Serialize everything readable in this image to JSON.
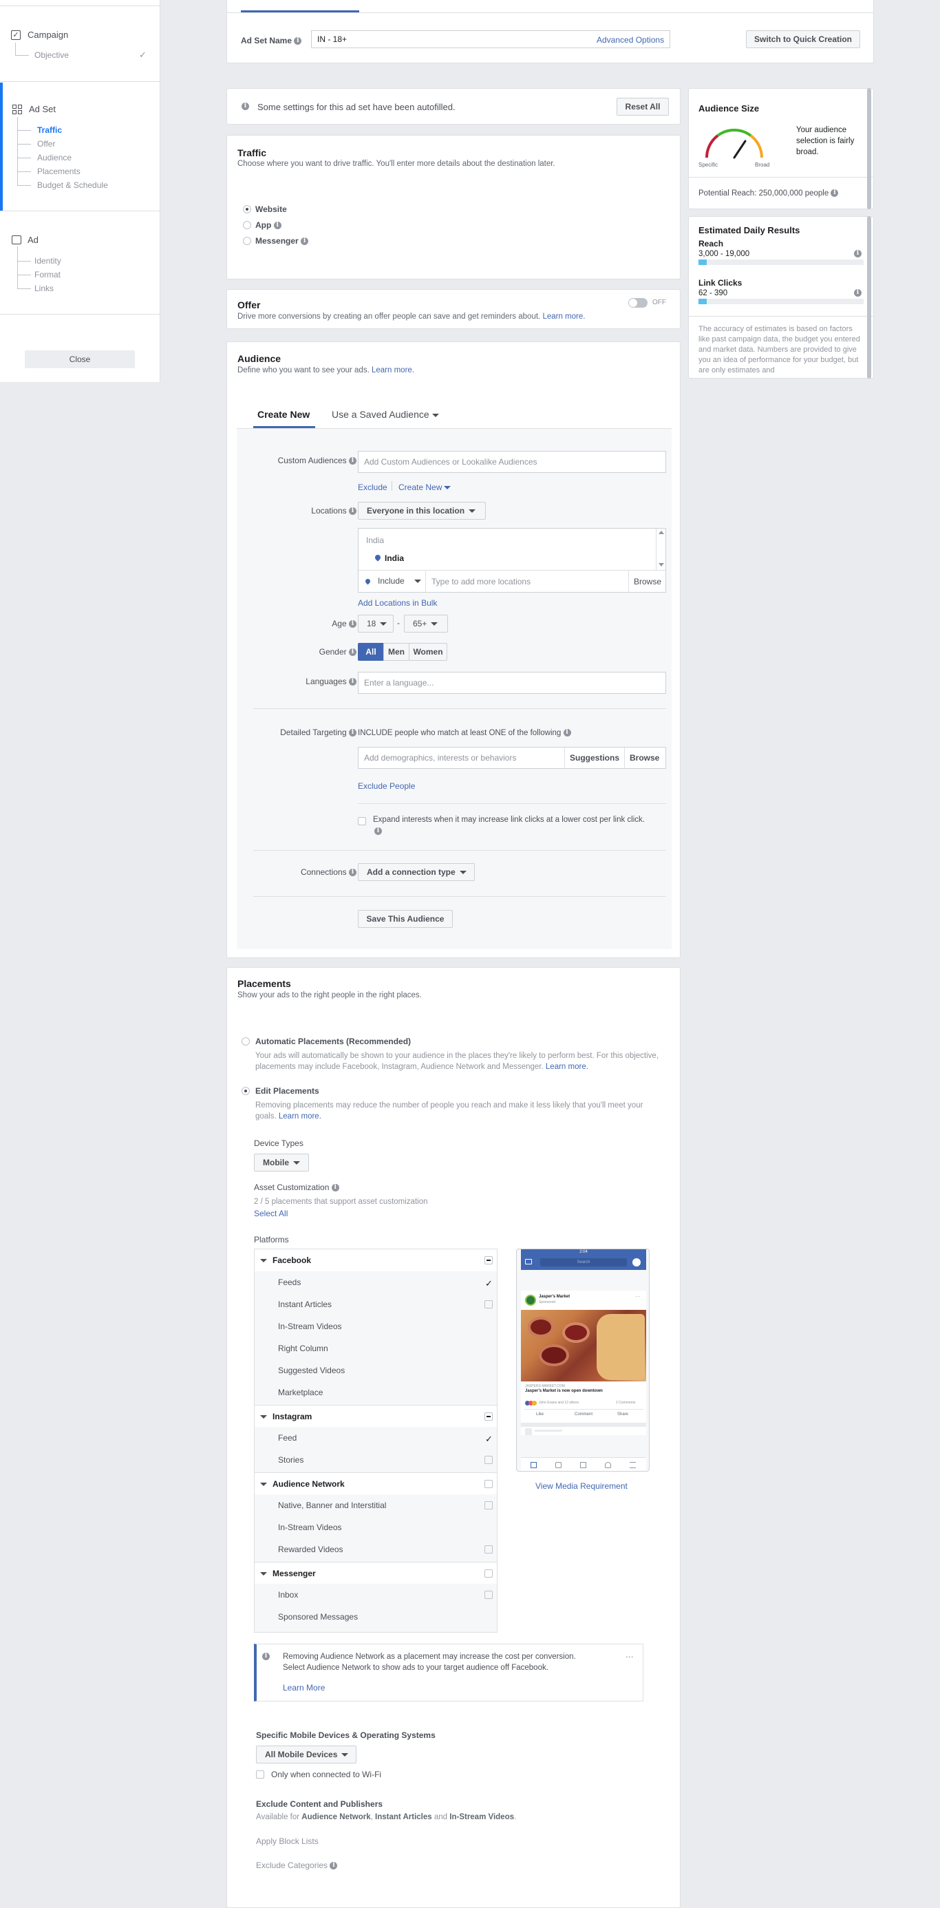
{
  "sidebar": {
    "campaign": {
      "title": "Campaign",
      "items": [
        "Objective"
      ]
    },
    "adset": {
      "title": "Ad Set",
      "items": [
        "Traffic",
        "Offer",
        "Audience",
        "Placements",
        "Budget & Schedule"
      ]
    },
    "ad": {
      "title": "Ad",
      "items": [
        "Identity",
        "Format",
        "Links"
      ]
    },
    "close_label": "Close"
  },
  "adset_name": {
    "label": "Ad Set Name",
    "value": "IN - 18+",
    "advanced_link": "Advanced Options",
    "quick_button": "Switch to Quick Creation"
  },
  "autofill": {
    "message": "Some settings for this ad set have been autofilled.",
    "reset_button": "Reset All"
  },
  "traffic": {
    "title": "Traffic",
    "description": "Choose where you want to drive traffic. You'll enter more details about the destination later.",
    "options": [
      "Website",
      "App",
      "Messenger"
    ],
    "selected": "Website"
  },
  "offer": {
    "title": "Offer",
    "description": "Drive more conversions by creating an offer people can save and get reminders about.",
    "learn_more": "Learn more.",
    "toggle_label": "OFF"
  },
  "audience": {
    "title": "Audience",
    "description": "Define who you want to see your ads.",
    "learn_more": "Learn more.",
    "tabs": [
      "Create New",
      "Use a Saved Audience"
    ],
    "custom_audiences_label": "Custom Audiences",
    "custom_audiences_placeholder": "Add Custom Audiences or Lookalike Audiences",
    "exclude_link": "Exclude",
    "create_new_link": "Create New",
    "locations_label": "Locations",
    "locations_dropdown": "Everyone in this location",
    "location_group": "India",
    "location_item": "India",
    "include_dropdown": "Include",
    "location_placeholder": "Type to add more locations",
    "browse": "Browse",
    "bulk_link": "Add Locations in Bulk",
    "age_label": "Age",
    "age_min": "18",
    "age_dash": "-",
    "age_max": "65+",
    "gender_label": "Gender",
    "genders": [
      "All",
      "Men",
      "Women"
    ],
    "selected_gender": "All",
    "languages_label": "Languages",
    "languages_placeholder": "Enter a language...",
    "detailed_label": "Detailed Targeting",
    "detailed_heading": "INCLUDE people who match at least ONE of the following",
    "detailed_placeholder": "Add demographics, interests or behaviors",
    "suggestions": "Suggestions",
    "detailed_browse": "Browse",
    "exclude_people": "Exclude People",
    "expand_text": "Expand interests when it may increase link clicks at a lower cost per link click.",
    "connections_label": "Connections",
    "connections_dropdown": "Add a connection type",
    "save_button": "Save This Audience"
  },
  "audience_size": {
    "title": "Audience Size",
    "gauge_specific": "Specific",
    "gauge_broad": "Broad",
    "gauge_level": 0.62,
    "description": "Your audience selection is fairly broad.",
    "potential_reach": "Potential Reach: 250,000,000 people"
  },
  "estimates": {
    "title": "Estimated Daily Results",
    "reach_label": "Reach",
    "reach_value": "3,000 - 19,000",
    "reach_fill": 0.05,
    "clicks_label": "Link Clicks",
    "clicks_value": "62 - 390",
    "clicks_fill": 0.05,
    "disclaimer": "The accuracy of estimates is based on factors like past campaign data, the budget you entered and market data. Numbers are provided to give you an idea of performance for your budget, but are only estimates and"
  },
  "placements": {
    "title": "Placements",
    "description": "Show your ads to the right people in the right places.",
    "auto_title": "Automatic Placements (Recommended)",
    "auto_description": "Your ads will automatically be shown to your audience in the places they're likely to perform best. For this objective, placements may include Facebook, Instagram, Audience Network and Messenger.",
    "auto_learn_more": "Learn more.",
    "edit_title": "Edit Placements",
    "edit_description": "Removing placements may reduce the number of people you reach and make it less likely that you'll meet your goals.",
    "edit_learn_more": "Learn more.",
    "device_types_label": "Device Types",
    "device_type": "Mobile",
    "asset_label": "Asset Customization",
    "asset_text": "2 / 5 placements that support asset customization",
    "select_all": "Select All",
    "platforms_label": "Platforms",
    "platforms": [
      {
        "name": "Facebook",
        "items": [
          "Feeds",
          "Instant Articles",
          "In-Stream Videos",
          "Right Column",
          "Suggested Videos",
          "Marketplace"
        ]
      },
      {
        "name": "Instagram",
        "items": [
          "Feed",
          "Stories"
        ]
      },
      {
        "name": "Audience Network",
        "items": [
          "Native, Banner and Interstitial",
          "In-Stream Videos",
          "Rewarded Videos"
        ]
      },
      {
        "name": "Messenger",
        "items": [
          "Inbox",
          "Sponsored Messages"
        ]
      }
    ],
    "preview": {
      "status_time": "2:04",
      "search": "Search",
      "page_name": "Jasper's Market",
      "sponsored": "Sponsored",
      "link_domain": "JASPERS-MARKET.COM",
      "link_title": "Jasper's Market is now open downtown",
      "reactions": "John Evans and 13 others",
      "comments": "2 Comments",
      "like": "Like",
      "comment": "Comment",
      "share": "Share"
    },
    "view_media": "View Media Requirement",
    "notice_text": "Removing Audience Network as a placement may increase the cost per conversion. Select Audience Network to show ads to your target audience off Facebook.",
    "notice_link": "Learn More",
    "notice_more": "...",
    "devices_title": "Specific Mobile Devices & Operating Systems",
    "devices_dropdown": "All Mobile Devices",
    "wifi_label": "Only when connected to Wi-Fi",
    "exclude_title": "Exclude Content and Publishers",
    "exclude_prefix": "Available for",
    "exclude_an": "Audience Network",
    "exclude_comma": ",",
    "exclude_ia": "Instant Articles",
    "exclude_and": "and",
    "exclude_isv": "In-Stream Videos",
    "exclude_dot": ".",
    "block_lists": "Apply Block Lists",
    "exclude_categories": "Exclude Categories"
  },
  "colors": {
    "accent": "#4267b2",
    "active_blue": "#1877f2",
    "page_bg": "#e9ebee",
    "gauge_red": "#c41e3a",
    "gauge_orange": "#f6a623",
    "gauge_green": "#42b72a"
  }
}
